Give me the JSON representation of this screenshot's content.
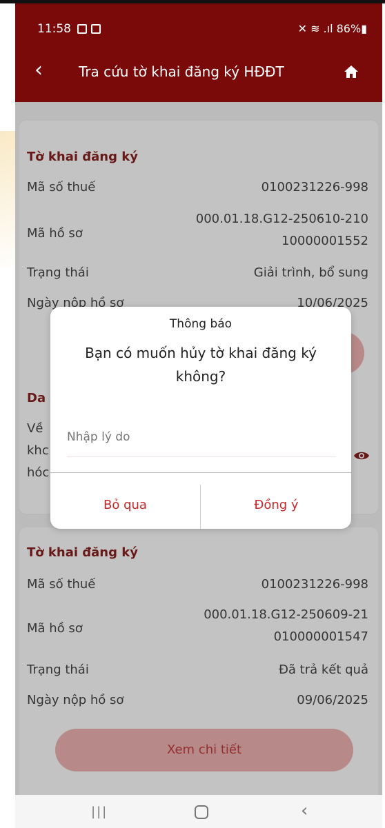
{
  "status_bar": {
    "time": "11:58",
    "right": "86%"
  },
  "header": {
    "back_icon": "chevron-left-icon",
    "title": "Tra cứu tờ khai đăng ký HĐĐT",
    "home_icon": "home-icon"
  },
  "record1": {
    "section_title": "Tờ khai đăng ký",
    "tax_code_label": "Mã số thuế",
    "tax_code_value": "0100231226-998",
    "file_code_label": "Mã hồ sơ",
    "file_code_line1": "000.01.18.G12-250610-210",
    "file_code_line2": "10000001552",
    "status_label": "Trạng thái",
    "status_value": "Giải trình, bổ sung",
    "date_label": "Ngày nộp hồ sơ",
    "date_value": "10/06/2025",
    "partial_section": "Da",
    "partial_row1": "Về",
    "partial_row2": "khc",
    "partial_row3": "hóc"
  },
  "dialog": {
    "title": "Thông báo",
    "message": "Bạn có muốn hủy tờ khai đăng ký không?",
    "input_placeholder": "Nhập lý do",
    "cancel_label": "Bỏ qua",
    "confirm_label": "Đồng ý"
  },
  "record2": {
    "section_title": "Tờ khai đăng ký",
    "tax_code_label": "Mã số thuế",
    "tax_code_value": "0100231226-998",
    "file_code_label": "Mã hồ sơ",
    "file_code_line1": "000.01.18.G12-250609-21",
    "file_code_line2": "010000001547",
    "status_label": "Trạng thái",
    "status_value": "Đã trả kết quả",
    "date_label": "Ngày nộp hồ sơ",
    "date_value": "09/06/2025",
    "detail_button": "Xem chi tiết"
  },
  "colors": {
    "header": "#7a0a0a",
    "accent": "#c62828"
  }
}
